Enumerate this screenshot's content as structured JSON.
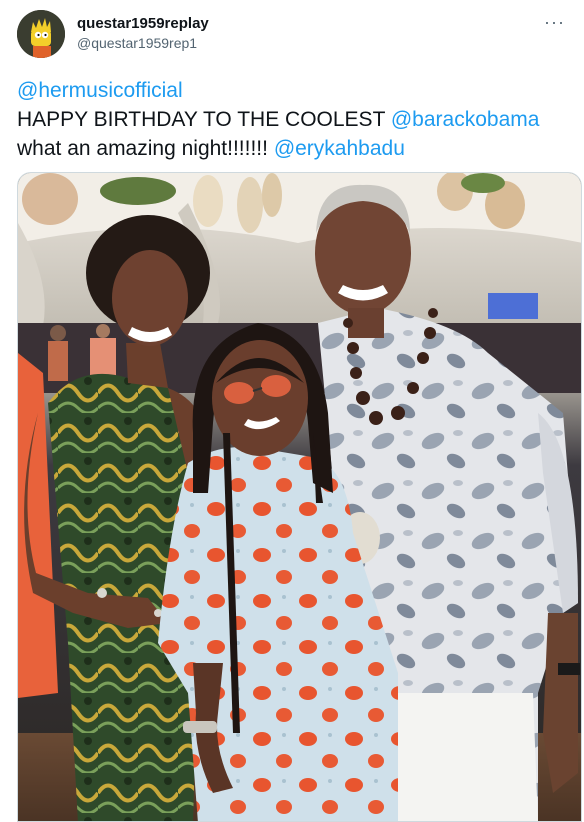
{
  "author": {
    "display_name": "questar1959replay",
    "handle": "@questar1959rep1",
    "avatar_icon": "cartoon-avatar-icon"
  },
  "menu": {
    "more_label": "···",
    "icon": "more-horizontal-icon"
  },
  "tweet": {
    "line1_mention": "@hermusicofficial",
    "line2_text": "HAPPY BIRTHDAY TO THE COOLEST ",
    "line2_mention": "@barackobama",
    "line3_text": "what an amazing night!!!!!!! ",
    "line3_mention": "@erykahbadu"
  },
  "media": {
    "kind": "photo",
    "subject": "three-people-at-party"
  },
  "colors": {
    "link": "#1d9bf0",
    "text": "#0f1419",
    "secondary": "#536471",
    "border": "#cfd9de"
  }
}
